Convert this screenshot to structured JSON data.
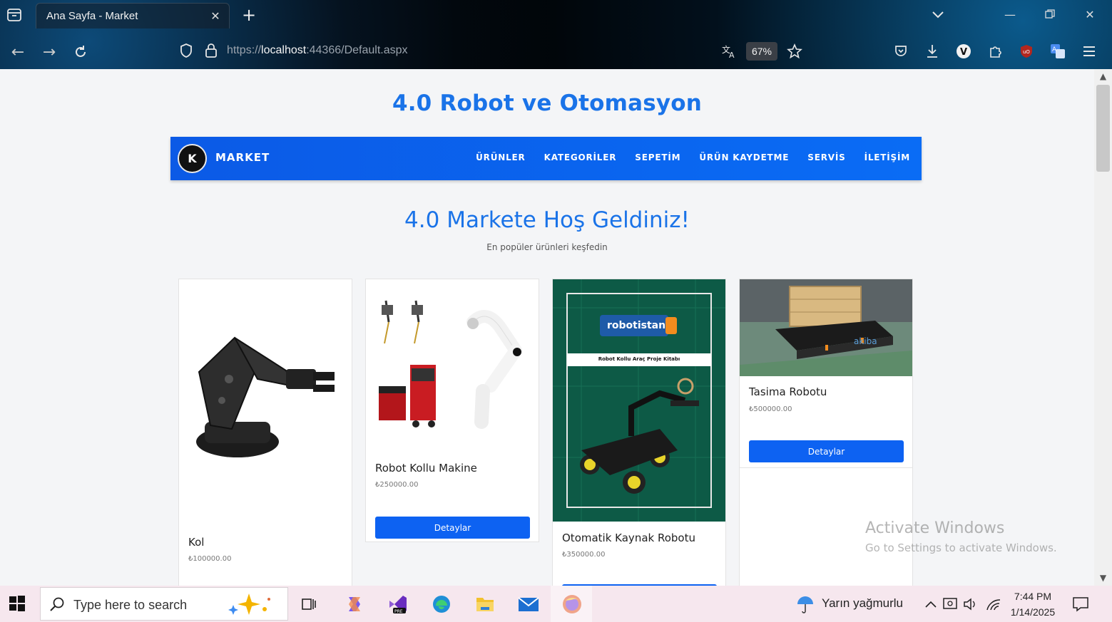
{
  "browser": {
    "tab_title": "Ana Sayfa - Market",
    "url_scheme": "https://",
    "url_host": "localhost",
    "url_rest": ":44366/Default.aspx",
    "zoom": "67%"
  },
  "site": {
    "title": "4.0 Robot ve Otomasyon",
    "brand": "MARKET",
    "logo_text": "K",
    "menu": [
      "ÜRÜNLER",
      "KATEGORİLER",
      "SEPETİM",
      "ÜRÜN KAYDETME",
      "SERVİS",
      "İLETİŞİM"
    ],
    "welcome": "4.0 Markete Hoş Geldiniz!",
    "subtitle": "En popüler ürünleri keşfedin",
    "detail_label": "Detaylar"
  },
  "products": [
    {
      "name": "Kol",
      "price": "₺100000.00"
    },
    {
      "name": "Robot Kollu Makine",
      "price": "₺250000.00"
    },
    {
      "name": "Otomatik Kaynak Robotu",
      "price": "₺350000.00",
      "book_brand": "robotistan",
      "book_caption": "Robot Kollu Araç Proje Kitabı"
    },
    {
      "name": "Tasima Robotu",
      "price": "₺500000.00",
      "robot_brand": "akiba"
    }
  ],
  "watermark": {
    "line1": "Activate Windows",
    "line2": "Go to Settings to activate Windows."
  },
  "taskbar": {
    "search_placeholder": "Type here to search",
    "weather": "Yarın yağmurlu",
    "time": "7:44 PM",
    "date": "1/14/2025"
  },
  "colors": {
    "accent": "#1a73e8",
    "nav_bg": "#0b5ae6",
    "button": "#0d62f2"
  }
}
